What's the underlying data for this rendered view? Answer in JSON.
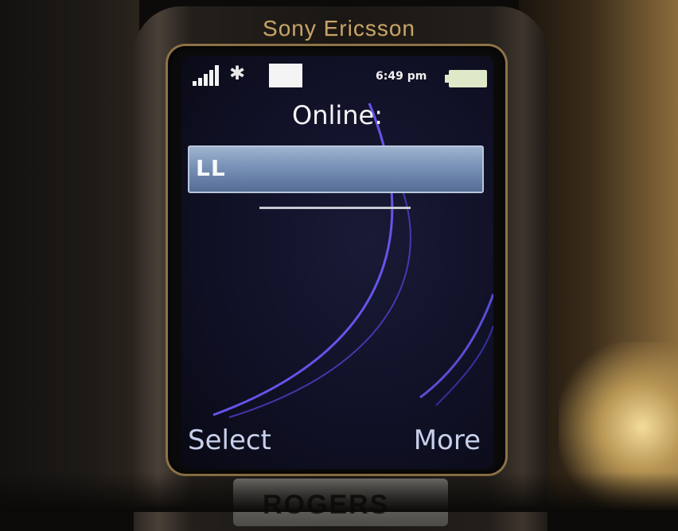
{
  "brand": "Sony Ericsson",
  "status_bar": {
    "time": "6:49 pm",
    "icons": [
      "signal-strength-icon",
      "bluetooth-icon",
      "battery-icon"
    ]
  },
  "screen": {
    "title": "Online:",
    "list_items": [
      {
        "label": "LL",
        "selected": true
      }
    ]
  },
  "softkeys": {
    "left_label": "Select",
    "right_label": "More"
  },
  "carrier_logo_text": "ROGERS",
  "colors": {
    "highlight": "#7891b6",
    "screen_bg": "#101126",
    "brand_gold": "#c6a46a",
    "wallpaper_curve": "#6e5cff"
  }
}
